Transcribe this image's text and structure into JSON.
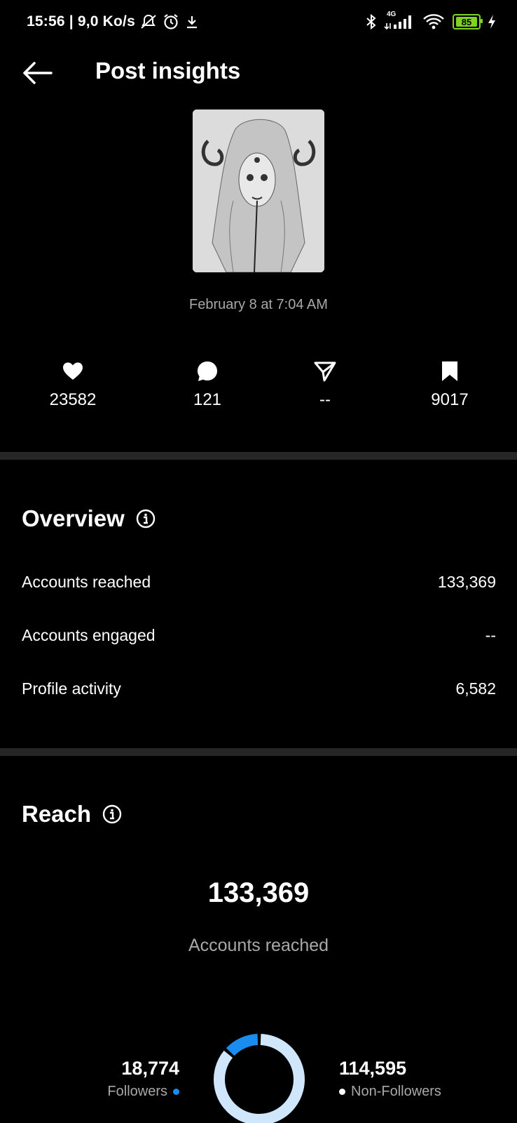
{
  "status_bar": {
    "time": "15:56",
    "speed": "| 9,0 Ko/s",
    "network": "4G",
    "battery": "85"
  },
  "header": {
    "title": "Post insights"
  },
  "post": {
    "date": "February 8 at 7:04 AM"
  },
  "stats": [
    {
      "icon": "heart-icon",
      "value": "23582"
    },
    {
      "icon": "comment-icon",
      "value": "121"
    },
    {
      "icon": "share-icon",
      "value": "--"
    },
    {
      "icon": "bookmark-icon",
      "value": "9017"
    }
  ],
  "overview": {
    "title": "Overview",
    "rows": [
      {
        "label": "Accounts reached",
        "value": "133,369"
      },
      {
        "label": "Accounts engaged",
        "value": "--"
      },
      {
        "label": "Profile activity",
        "value": "6,582"
      }
    ]
  },
  "reach": {
    "title": "Reach",
    "total": "133,369",
    "total_label": "Accounts reached",
    "followers": {
      "value": "18,774",
      "label": "Followers"
    },
    "non_followers": {
      "value": "114,595",
      "label": "Non-Followers"
    },
    "followers_share": 0.141
  },
  "colors": {
    "accent": "#1a8cf0",
    "light_accent": "#cfe6fb",
    "muted": "#a8a8a8",
    "divider": "#262626",
    "battery": "#7ed321"
  }
}
